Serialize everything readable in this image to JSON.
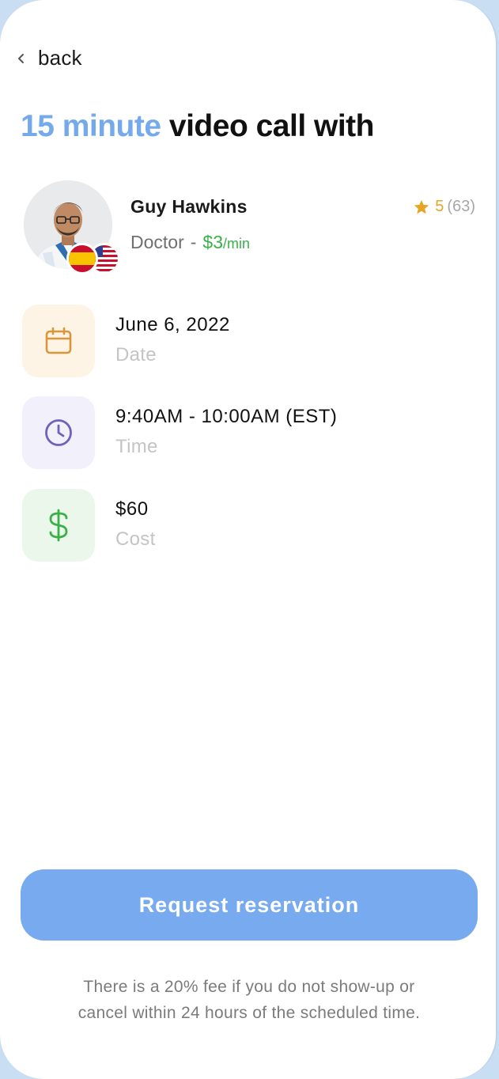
{
  "nav": {
    "back_label": "back"
  },
  "header": {
    "title_accent": "15 minute",
    "title_rest": "video call with"
  },
  "provider": {
    "name": "Guy Hawkins",
    "role": "Doctor",
    "separator": "-",
    "price": "$3",
    "price_unit": "/min",
    "rating": "5",
    "rating_count": "(63)",
    "languages": [
      "spanish-flag-icon",
      "us-flag-icon"
    ]
  },
  "details": {
    "date": {
      "value": "June 6, 2022",
      "label": "Date",
      "icon": "calendar-icon"
    },
    "time": {
      "value": "9:40AM - 10:00AM (EST)",
      "label": "Time",
      "icon": "clock-icon"
    },
    "cost": {
      "value": "$60",
      "label": "Cost",
      "icon": "dollar-icon"
    }
  },
  "action": {
    "request_label": "Request reservation"
  },
  "footer": {
    "note_line1": "There is a 20% fee if you do not show-up or",
    "note_line2": "cancel within 24 hours of the scheduled time."
  },
  "colors": {
    "accent": "#74a9ec",
    "button": "#77aaee",
    "price_green": "#3bb049",
    "star": "#e5a624",
    "date_tint": "#fdf4e6",
    "time_tint": "#f1f0fb",
    "cost_tint": "#eaf7ea"
  }
}
